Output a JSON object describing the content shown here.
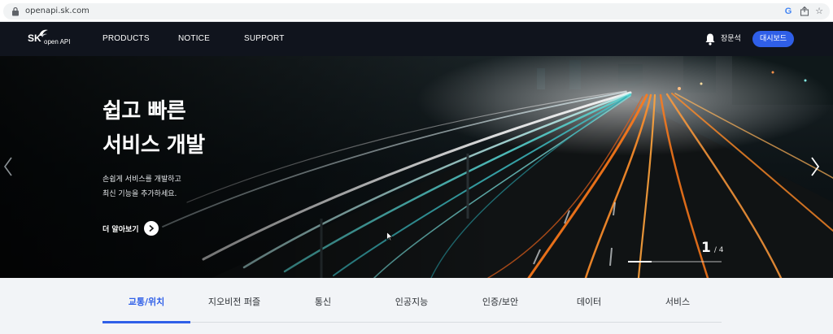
{
  "browser": {
    "url": "openapi.sk.com",
    "icons": [
      "lock-icon",
      "google-icon",
      "share-icon",
      "star-icon"
    ]
  },
  "nav": {
    "logo_sk": "SK",
    "logo_api": "open API",
    "items": [
      {
        "label": "PRODUCTS"
      },
      {
        "label": "NOTICE"
      },
      {
        "label": "SUPPORT"
      }
    ],
    "user_name": "장문석",
    "dashboard_label": "대시보드",
    "accent": "#2f5fe8"
  },
  "hero": {
    "title_line1": "쉽고 빠른",
    "title_line2": "서비스 개발",
    "desc_line1": "손쉽게 서비스를 개발하고",
    "desc_line2": "최신 기능을 추가하세요.",
    "learn_more": "더 알아보기",
    "page_current": "1",
    "page_total": "/ 4",
    "progress": 0.25
  },
  "tabs": [
    {
      "label": "교통/위치",
      "active": true
    },
    {
      "label": "지오비전 퍼즐"
    },
    {
      "label": "통신"
    },
    {
      "label": "인공지능"
    },
    {
      "label": "인증/보안"
    },
    {
      "label": "데이터"
    },
    {
      "label": "서비스"
    }
  ]
}
